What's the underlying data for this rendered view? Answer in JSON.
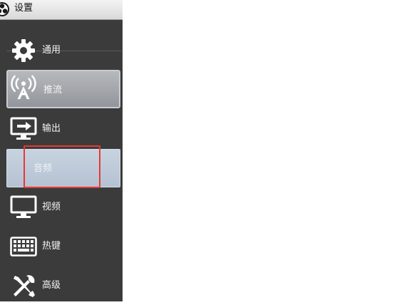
{
  "window": {
    "title": "设置",
    "app_icon": "obs-logo-icon"
  },
  "sidebar": {
    "items": [
      {
        "id": "general",
        "label": "通用",
        "icon": "gear-icon"
      },
      {
        "id": "stream",
        "label": "推流",
        "icon": "broadcast-antenna-icon"
      },
      {
        "id": "output",
        "label": "输出",
        "icon": "monitor-arrow-icon"
      },
      {
        "id": "audio",
        "label": "音频",
        "icon": ""
      },
      {
        "id": "video",
        "label": "视频",
        "icon": "monitor-icon"
      },
      {
        "id": "hotkeys",
        "label": "热键",
        "icon": "keyboard-icon"
      },
      {
        "id": "advanced",
        "label": "高级",
        "icon": "tools-icon"
      }
    ],
    "selected_item": "audio",
    "highlighted_item": "audio"
  },
  "colors": {
    "sidebar_bg": "#3b3b3b",
    "highlight_border": "#e53935",
    "selected_blue": "#c0ccdb"
  }
}
